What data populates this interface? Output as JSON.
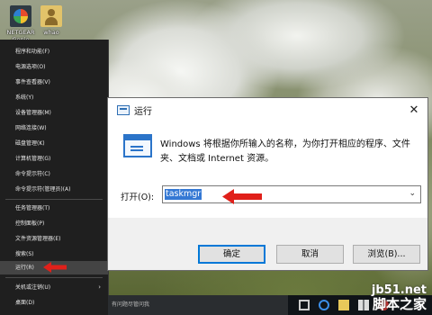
{
  "desktop": {
    "icons": [
      {
        "label": "NETGEAR Genie",
        "icon": "netgear-genie-icon"
      },
      {
        "label": "whao",
        "icon": "user-folder-icon"
      }
    ]
  },
  "winx_menu": {
    "items": [
      {
        "label": "程序和功能(F)"
      },
      {
        "label": "电源选项(O)"
      },
      {
        "label": "事件查看器(V)"
      },
      {
        "label": "系统(Y)"
      },
      {
        "label": "设备管理器(M)"
      },
      {
        "label": "网络连接(W)"
      },
      {
        "label": "磁盘管理(K)"
      },
      {
        "label": "计算机管理(G)"
      },
      {
        "label": "命令提示符(C)"
      },
      {
        "label": "命令提示符(管理员)(A)"
      },
      {
        "label": "任务管理器(T)"
      },
      {
        "label": "控制面板(P)"
      },
      {
        "label": "文件资源管理器(E)"
      },
      {
        "label": "搜索(S)"
      },
      {
        "label": "运行(R)"
      },
      {
        "label": "关机或注销(U)"
      },
      {
        "label": "桌面(D)"
      }
    ],
    "submenu_chevron": "›"
  },
  "taskbar": {
    "search_text": "有问题尽管问我"
  },
  "run_dialog": {
    "title": "运行",
    "close_glyph": "✕",
    "description": "Windows 将根据你所输入的名称，为你打开相应的程序、文件夹、文档或 Internet 资源。",
    "open_label": "打开(O):",
    "input_value": "taskmgr",
    "dropdown_glyph": "⌄",
    "buttons": {
      "ok": "确定",
      "cancel": "取消",
      "browse": "浏览(B)..."
    }
  },
  "watermark": {
    "site": "jb51.net",
    "brand": "脚本之家"
  },
  "colors": {
    "annotation_red": "#e0201a",
    "selection_blue": "#3478d4",
    "default_button_border": "#0078d7"
  }
}
